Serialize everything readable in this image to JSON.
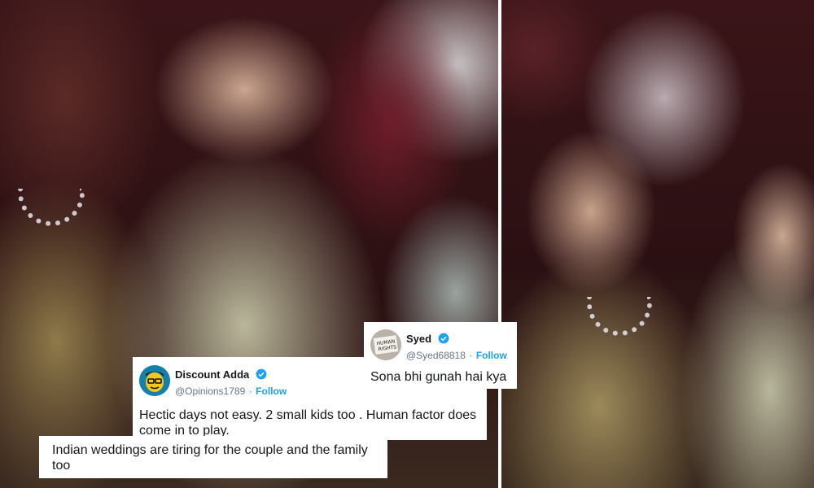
{
  "photos": {
    "left_alt": "Couple seated at a wedding event, groom looking tired",
    "right_alt": "Bride seated next to groom"
  },
  "tweets": [
    {
      "id": "discount-adda",
      "name": "Discount Adda",
      "handle": "@Opinions1789",
      "separator": "·",
      "follow": "Follow",
      "text": "Hectic days not easy. 2 small kids too . Human factor does come in to play.",
      "avatar_icon": "cartoon-face-icon"
    },
    {
      "id": "syed",
      "name": "Syed",
      "handle": "@Syed68818",
      "separator": "·",
      "follow": "Follow",
      "text": "Sona bhi gunah hai kya",
      "avatar_icon": "human-rights-sign-icon"
    }
  ],
  "comment_box": {
    "text": "Indian weddings are tiring for the couple and the family too"
  },
  "colors": {
    "verified": "#1da1f2",
    "follow": "#1da1f2",
    "handle": "#657786"
  }
}
